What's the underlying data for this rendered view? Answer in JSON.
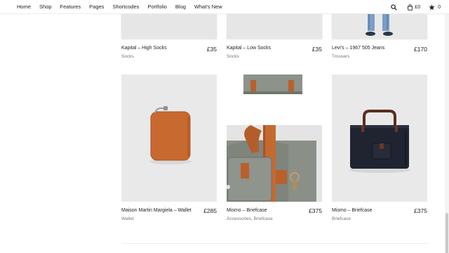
{
  "nav": {
    "items": [
      {
        "label": "Home"
      },
      {
        "label": "Shop"
      },
      {
        "label": "Features"
      },
      {
        "label": "Pages"
      },
      {
        "label": "Shortcodes"
      },
      {
        "label": "Portfolio"
      },
      {
        "label": "Blog"
      },
      {
        "label": "What's New"
      }
    ],
    "cart_amount": "£0",
    "wishlist_count": "0",
    "icons": {
      "search": "search-icon",
      "cart": "bag-icon",
      "wishlist": "star-icon"
    }
  },
  "products": [
    {
      "title": "Kapital – High Socks",
      "price": "£35",
      "category": "Socks"
    },
    {
      "title": "Kapital – Low Socks",
      "price": "£35",
      "category": "Socks"
    },
    {
      "title": "Levi's – 1967 505 Jeans",
      "price": "£170",
      "category": "Trousers"
    },
    {
      "title": "Maison Martin Margiela – Wallet",
      "price": "£285",
      "category": "Wallet"
    },
    {
      "title": "Mismo – Briefcase",
      "price": "£375",
      "category": "Accessories, Briefcase"
    },
    {
      "title": "Mismo – Briefcase",
      "price": "£375",
      "category": "Briefcase"
    }
  ],
  "colors": {
    "image_bg": "#e8e8e8",
    "leather": "#c8692f",
    "canvas_grey": "#8a8f88",
    "navy": "#1f2430"
  }
}
